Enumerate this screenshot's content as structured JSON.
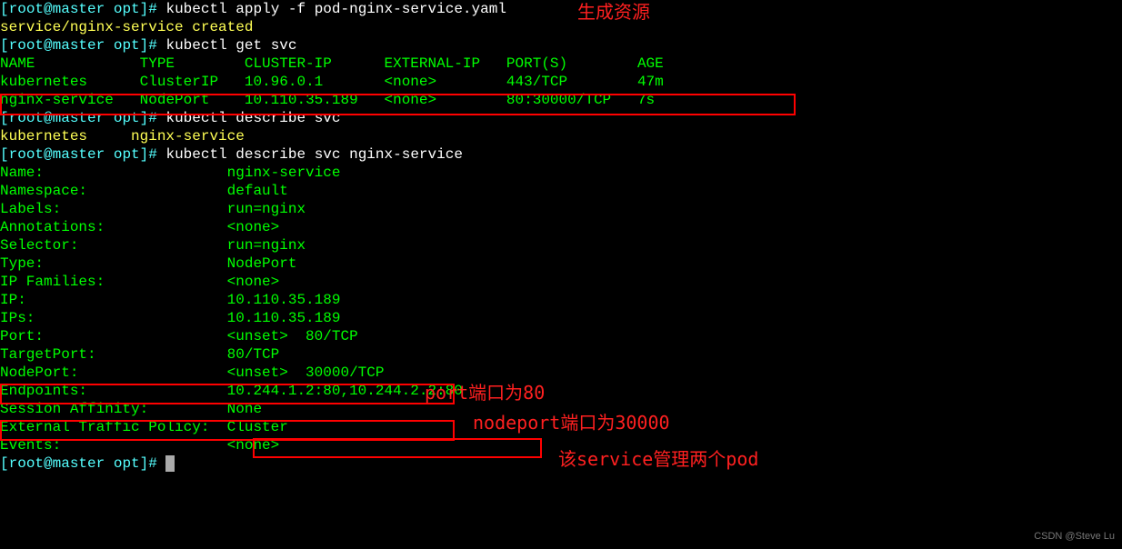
{
  "prompt_open": "[",
  "prompt_user": "root@master",
  "prompt_sep": " ",
  "prompt_dir": "opt",
  "prompt_close": "]# ",
  "cmd1": "kubectl apply -f pod-nginx-service.yaml",
  "out1": "service/nginx-service created",
  "cmd2": "kubectl get svc",
  "svc_header": {
    "name": "NAME",
    "type": "TYPE",
    "cluster_ip": "CLUSTER-IP",
    "external_ip": "EXTERNAL-IP",
    "ports": "PORT(S)",
    "age": "AGE"
  },
  "svc_rows": [
    {
      "name": "kubernetes",
      "type": "ClusterIP",
      "cluster_ip": "10.96.0.1",
      "external_ip": "<none>",
      "ports": "443/TCP",
      "age": "47m"
    },
    {
      "name": "nginx-service",
      "type": "NodePort",
      "cluster_ip": "10.110.35.189",
      "external_ip": "<none>",
      "ports": "80:30000/TCP",
      "age": "7s"
    }
  ],
  "cmd3": "kubectl describe svc",
  "out3": "kubernetes     nginx-service",
  "cmd4": "kubectl describe svc nginx-service",
  "desc": {
    "Name:": "nginx-service",
    "Namespace:": "default",
    "Labels:": "run=nginx",
    "Annotations:": "<none>",
    "Selector:": "run=nginx",
    "Type:": "NodePort",
    "IP Families:": "<none>",
    "IP:": "10.110.35.189",
    "IPs:": "10.110.35.189",
    "Port:": "<unset>  80/TCP",
    "TargetPort:": "80/TCP",
    "NodePort:": "<unset>  30000/TCP",
    "Endpoints:": "10.244.1.2:80,10.244.2.2:80",
    "Session Affinity:": "None",
    "External Traffic Policy:": "Cluster",
    "Events:": "<none>"
  },
  "annot": {
    "a1": "生成资源",
    "a2": "port端口为80",
    "a3": "nodeport端口为30000",
    "a4": "该service管理两个pod"
  },
  "watermark": "CSDN @Steve Lu"
}
